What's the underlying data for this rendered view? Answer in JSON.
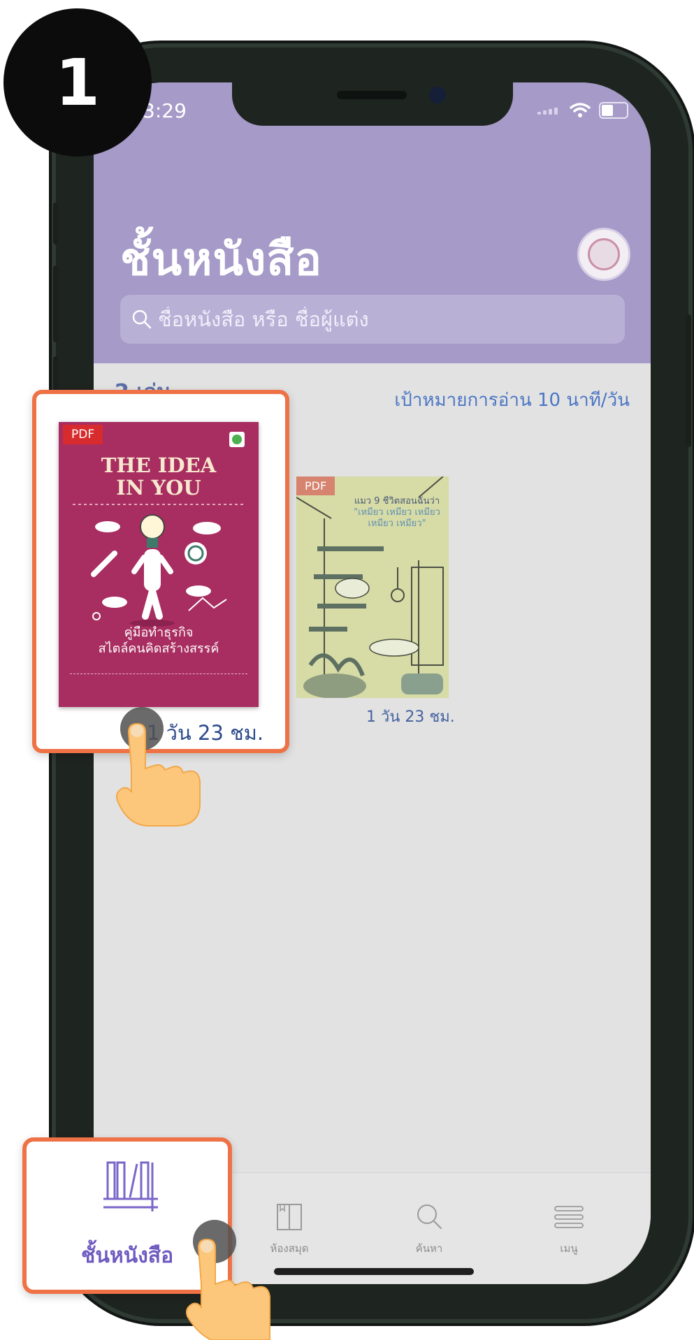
{
  "step": {
    "number": "1"
  },
  "status_bar": {
    "time": "3:29"
  },
  "header": {
    "title": "ชั้นหนังสือ",
    "search_placeholder": "ชื่อหนังสือ หรือ ชื่อผู้แต่ง"
  },
  "shelf": {
    "section_heading": "2 เล่ม",
    "reading_goal": "เป้าหมายการอ่าน 10 นาที/วัน",
    "books": [
      {
        "badge": "PDF",
        "title_lines": [
          "THE IDEA",
          "IN YOU"
        ],
        "subtitle_lines": [
          "คู่มือทำธุรกิจ",
          "สไตล์คนคิดสร้างสรรค์"
        ],
        "time_left": "1 วัน 23 ชม.",
        "cover_color": "#a82d60"
      },
      {
        "badge": "PDF",
        "title_lines": [
          "แมว 9 ชีวิตสอนฉันว่า",
          "\"เหมียว เหมียว เหมียว",
          "เหมียว เหมียว\""
        ],
        "time_left": "1 วัน 23 ชม.",
        "cover_color": "#d7dba5"
      }
    ]
  },
  "tab_bar": {
    "items": [
      {
        "label": "ชั้นหนังสือ",
        "icon": "bookshelf-icon",
        "active": true
      },
      {
        "label": "ห้องสมุด",
        "icon": "library-icon",
        "active": false
      },
      {
        "label": "ค้นหา",
        "icon": "search-icon",
        "active": false
      },
      {
        "label": "เมนู",
        "icon": "menu-icon",
        "active": false
      }
    ]
  },
  "colors": {
    "header": "#a59ac8",
    "highlight_border": "#ee7246",
    "accent_text": "#4b76c5",
    "active_tab": "#6f5bc0"
  }
}
